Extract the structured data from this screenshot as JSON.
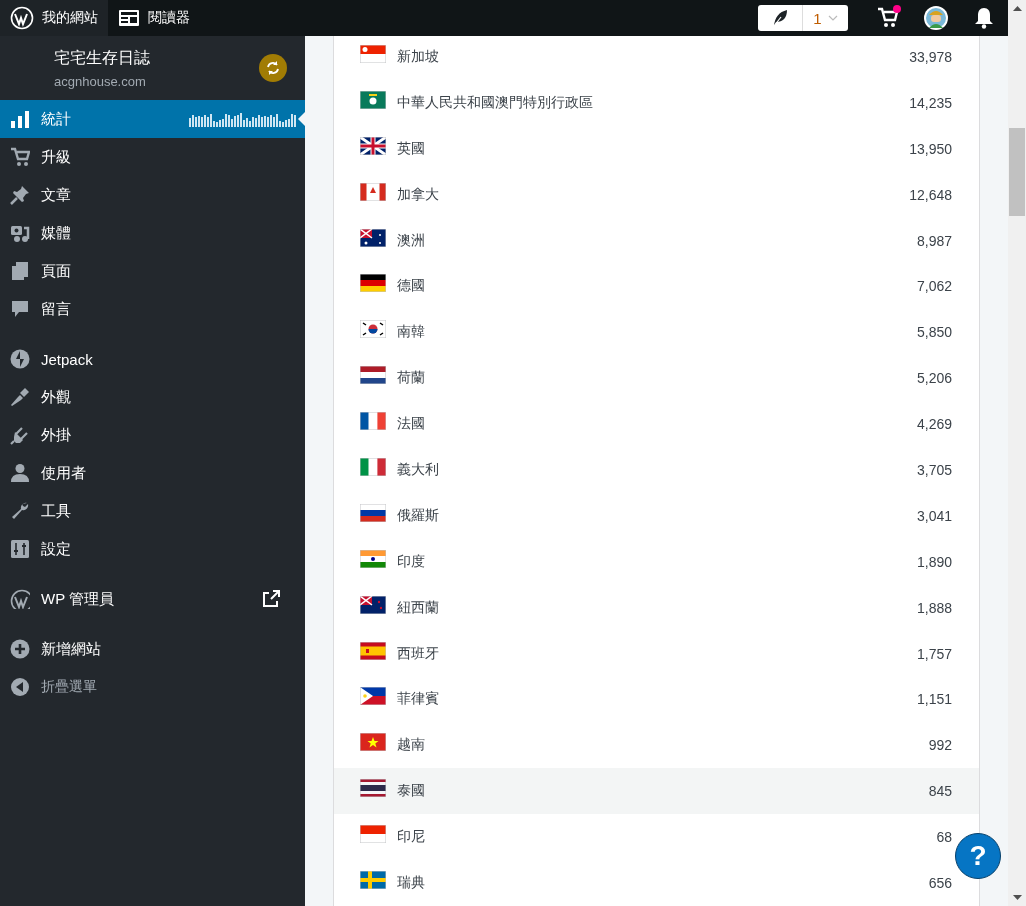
{
  "top_bar": {
    "tabs": [
      {
        "label": "我的網站",
        "selected": true
      },
      {
        "label": "閱讀器",
        "selected": false
      }
    ],
    "publish_count": "1",
    "cart_has_items": true
  },
  "site": {
    "title": "宅宅生存日誌",
    "domain": "acgnhouse.com"
  },
  "sidebar": {
    "groups": [
      {
        "items": [
          {
            "label": "統計",
            "kind": "stats",
            "selected": true
          },
          {
            "label": "升級",
            "kind": "menu",
            "selected": false
          },
          {
            "label": "文章",
            "kind": "menu",
            "selected": false
          },
          {
            "label": "媒體",
            "kind": "menu",
            "selected": false
          },
          {
            "label": "頁面",
            "kind": "menu",
            "selected": false
          },
          {
            "label": "留言",
            "kind": "menu",
            "selected": false
          }
        ]
      },
      {
        "items": [
          {
            "label": "Jetpack",
            "kind": "menu",
            "selected": false
          },
          {
            "label": "外觀",
            "kind": "menu",
            "selected": false
          },
          {
            "label": "外掛",
            "kind": "menu",
            "selected": false
          },
          {
            "label": "使用者",
            "kind": "menu",
            "selected": false
          },
          {
            "label": "工具",
            "kind": "menu",
            "selected": false
          },
          {
            "label": "設定",
            "kind": "menu",
            "selected": false
          }
        ]
      },
      {
        "items": [
          {
            "label": "WP 管理員",
            "kind": "external",
            "selected": false
          }
        ]
      },
      {
        "items": [
          {
            "label": "新增網站",
            "kind": "menu",
            "selected": false
          },
          {
            "label": "折疊選單",
            "kind": "collapse",
            "selected": false
          }
        ]
      }
    ]
  },
  "countries": [
    {
      "name": "新加坡",
      "views": "33,978",
      "highlighted": false
    },
    {
      "name": "中華人民共和國澳門特別行政區",
      "views": "14,235",
      "highlighted": false
    },
    {
      "name": "英國",
      "views": "13,950",
      "highlighted": false
    },
    {
      "name": "加拿大",
      "views": "12,648",
      "highlighted": false
    },
    {
      "name": "澳洲",
      "views": "8,987",
      "highlighted": false
    },
    {
      "name": "德國",
      "views": "7,062",
      "highlighted": false
    },
    {
      "name": "南韓",
      "views": "5,850",
      "highlighted": false
    },
    {
      "name": "荷蘭",
      "views": "5,206",
      "highlighted": false
    },
    {
      "name": "法國",
      "views": "4,269",
      "highlighted": false
    },
    {
      "name": "義大利",
      "views": "3,705",
      "highlighted": false
    },
    {
      "name": "俄羅斯",
      "views": "3,041",
      "highlighted": false
    },
    {
      "name": "印度",
      "views": "1,890",
      "highlighted": false
    },
    {
      "name": "紐西蘭",
      "views": "1,888",
      "highlighted": false
    },
    {
      "name": "西班牙",
      "views": "1,757",
      "highlighted": false
    },
    {
      "name": "菲律賓",
      "views": "1,151",
      "highlighted": false
    },
    {
      "name": "越南",
      "views": "992",
      "highlighted": false
    },
    {
      "name": "泰國",
      "views": "845",
      "highlighted": true
    },
    {
      "name": "印尼",
      "views": "68",
      "highlighted": false
    },
    {
      "name": "瑞典",
      "views": "656",
      "highlighted": false
    }
  ],
  "help_button": {
    "label": "?"
  }
}
